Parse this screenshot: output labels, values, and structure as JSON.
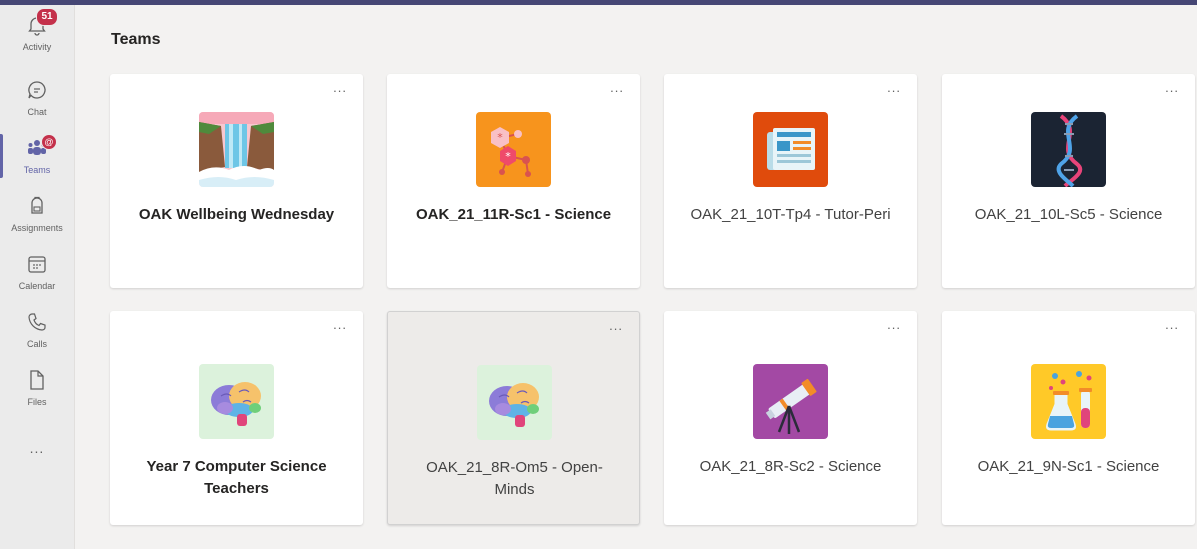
{
  "nav": {
    "activity": {
      "label": "Activity",
      "badge": "51"
    },
    "chat": {
      "label": "Chat"
    },
    "teams": {
      "label": "Teams",
      "badge": "@"
    },
    "assignments": {
      "label": "Assignments"
    },
    "calendar": {
      "label": "Calendar"
    },
    "calls": {
      "label": "Calls"
    },
    "files": {
      "label": "Files"
    },
    "more": "..."
  },
  "page": {
    "title": "Teams"
  },
  "cards": [
    {
      "name": "OAK Wellbeing Wednesday",
      "icon": "waterfall-icon",
      "more": "..."
    },
    {
      "name": "OAK_21_11R-Sc1 - Science",
      "icon": "molecule-icon",
      "more": "..."
    },
    {
      "name": "OAK_21_10T-Tp4 - Tutor-Peri",
      "icon": "newspaper-icon",
      "more": "..."
    },
    {
      "name": "OAK_21_10L-Sc5 - Science",
      "icon": "dna-icon",
      "more": "..."
    },
    {
      "name": "Year 7 Computer Science Teachers",
      "icon": "brain-icon",
      "more": "..."
    },
    {
      "name": "OAK_21_8R-Om5 - Open-Minds",
      "icon": "brain-icon",
      "more": "..."
    },
    {
      "name": "OAK_21_8R-Sc2 - Science",
      "icon": "telescope-icon",
      "more": "..."
    },
    {
      "name": "OAK_21_9N-Sc1 - Science",
      "icon": "flask-icon",
      "more": "..."
    }
  ],
  "colors": {
    "accent": "#6264a7",
    "badge": "#c4314b",
    "molecule_tile": "#f7941d",
    "newspaper_tile": "#e04b0c",
    "dna_tile": "#1b2433",
    "brain_tile": "#dcf2dc",
    "telescope_tile": "#a349a4",
    "flask_tile": "#ffc928"
  }
}
